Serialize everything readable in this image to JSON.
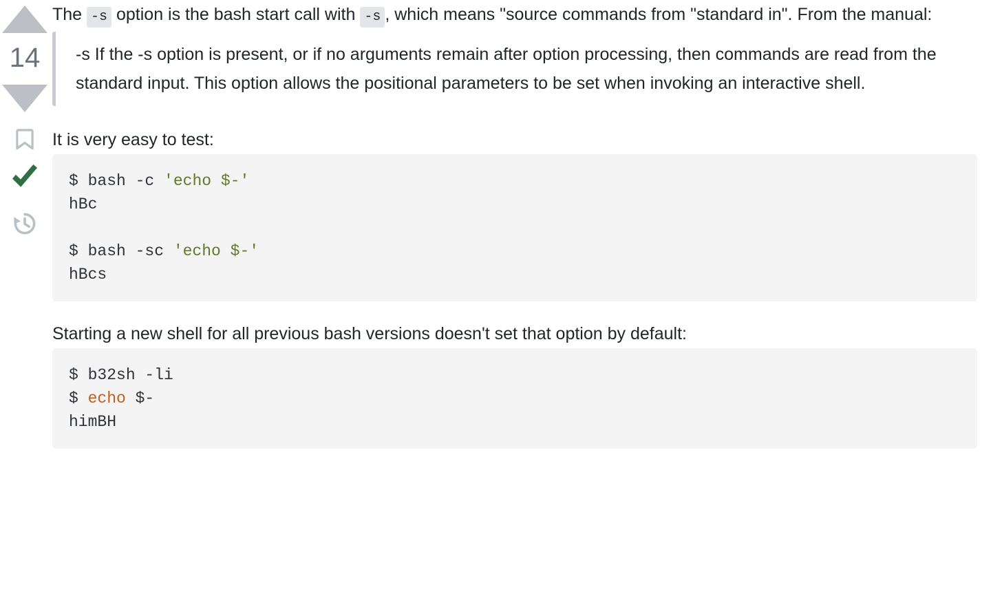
{
  "sidebar": {
    "upvote": {
      "name": "upvote-arrow",
      "label": "Up vote"
    },
    "downvote": {
      "name": "downvote-arrow",
      "label": "Down vote"
    },
    "vote_count": "14",
    "bookmark": {
      "name": "bookmark-icon",
      "label": "Bookmark"
    },
    "accepted": {
      "name": "accepted-check-icon",
      "label": "Accepted answer"
    },
    "history": {
      "name": "revision-history-icon",
      "label": "Revision history"
    }
  },
  "colors": {
    "arrow_gray": "#bcc0c4",
    "vote_count_gray": "#6a737c",
    "accepted_green": "#2f6f44",
    "icon_gray": "#bbc0c4",
    "code_bg": "#f4f4f4",
    "inline_code_bg": "#e3e6e8",
    "quote_border": "#c8ccd0",
    "quote_text": "#525960",
    "body_text": "#232629",
    "string_green": "#63792b",
    "keyword_orange": "#c25f1e"
  },
  "post": {
    "intro": {
      "part1": "The ",
      "code1": "-s",
      "part2": " option is the bash start call with ",
      "code2": "-s",
      "part3": ", which means \"source commands from \"standard in\". From the manual:"
    },
    "blockquote": "-s If the -s option is present, or if no arguments remain after option processing, then commands are read from the standard input. This option allows the positional parameters to be set when invoking an interactive shell.",
    "test_intro": "It is very easy to test:",
    "code_block_1": {
      "lines": [
        [
          {
            "t": "$ bash -c ",
            "c": "pln"
          },
          {
            "t": "'echo $-'",
            "c": "str"
          }
        ],
        [
          {
            "t": "hBc",
            "c": "pln"
          }
        ],
        [
          {
            "t": "",
            "c": "pln"
          }
        ],
        [
          {
            "t": "$ bash -sc ",
            "c": "pln"
          },
          {
            "t": "'echo $-'",
            "c": "str"
          }
        ],
        [
          {
            "t": "hBcs",
            "c": "pln"
          }
        ]
      ]
    },
    "start_intro": "Starting a new shell for all previous bash versions doesn't set that option by default:",
    "code_block_2": {
      "lines": [
        [
          {
            "t": "$ b32sh -li",
            "c": "pln"
          }
        ],
        [
          {
            "t": "$ ",
            "c": "pln"
          },
          {
            "t": "echo",
            "c": "kw"
          },
          {
            "t": " $-",
            "c": "pln"
          }
        ],
        [
          {
            "t": "himBH",
            "c": "pln"
          }
        ]
      ]
    }
  }
}
